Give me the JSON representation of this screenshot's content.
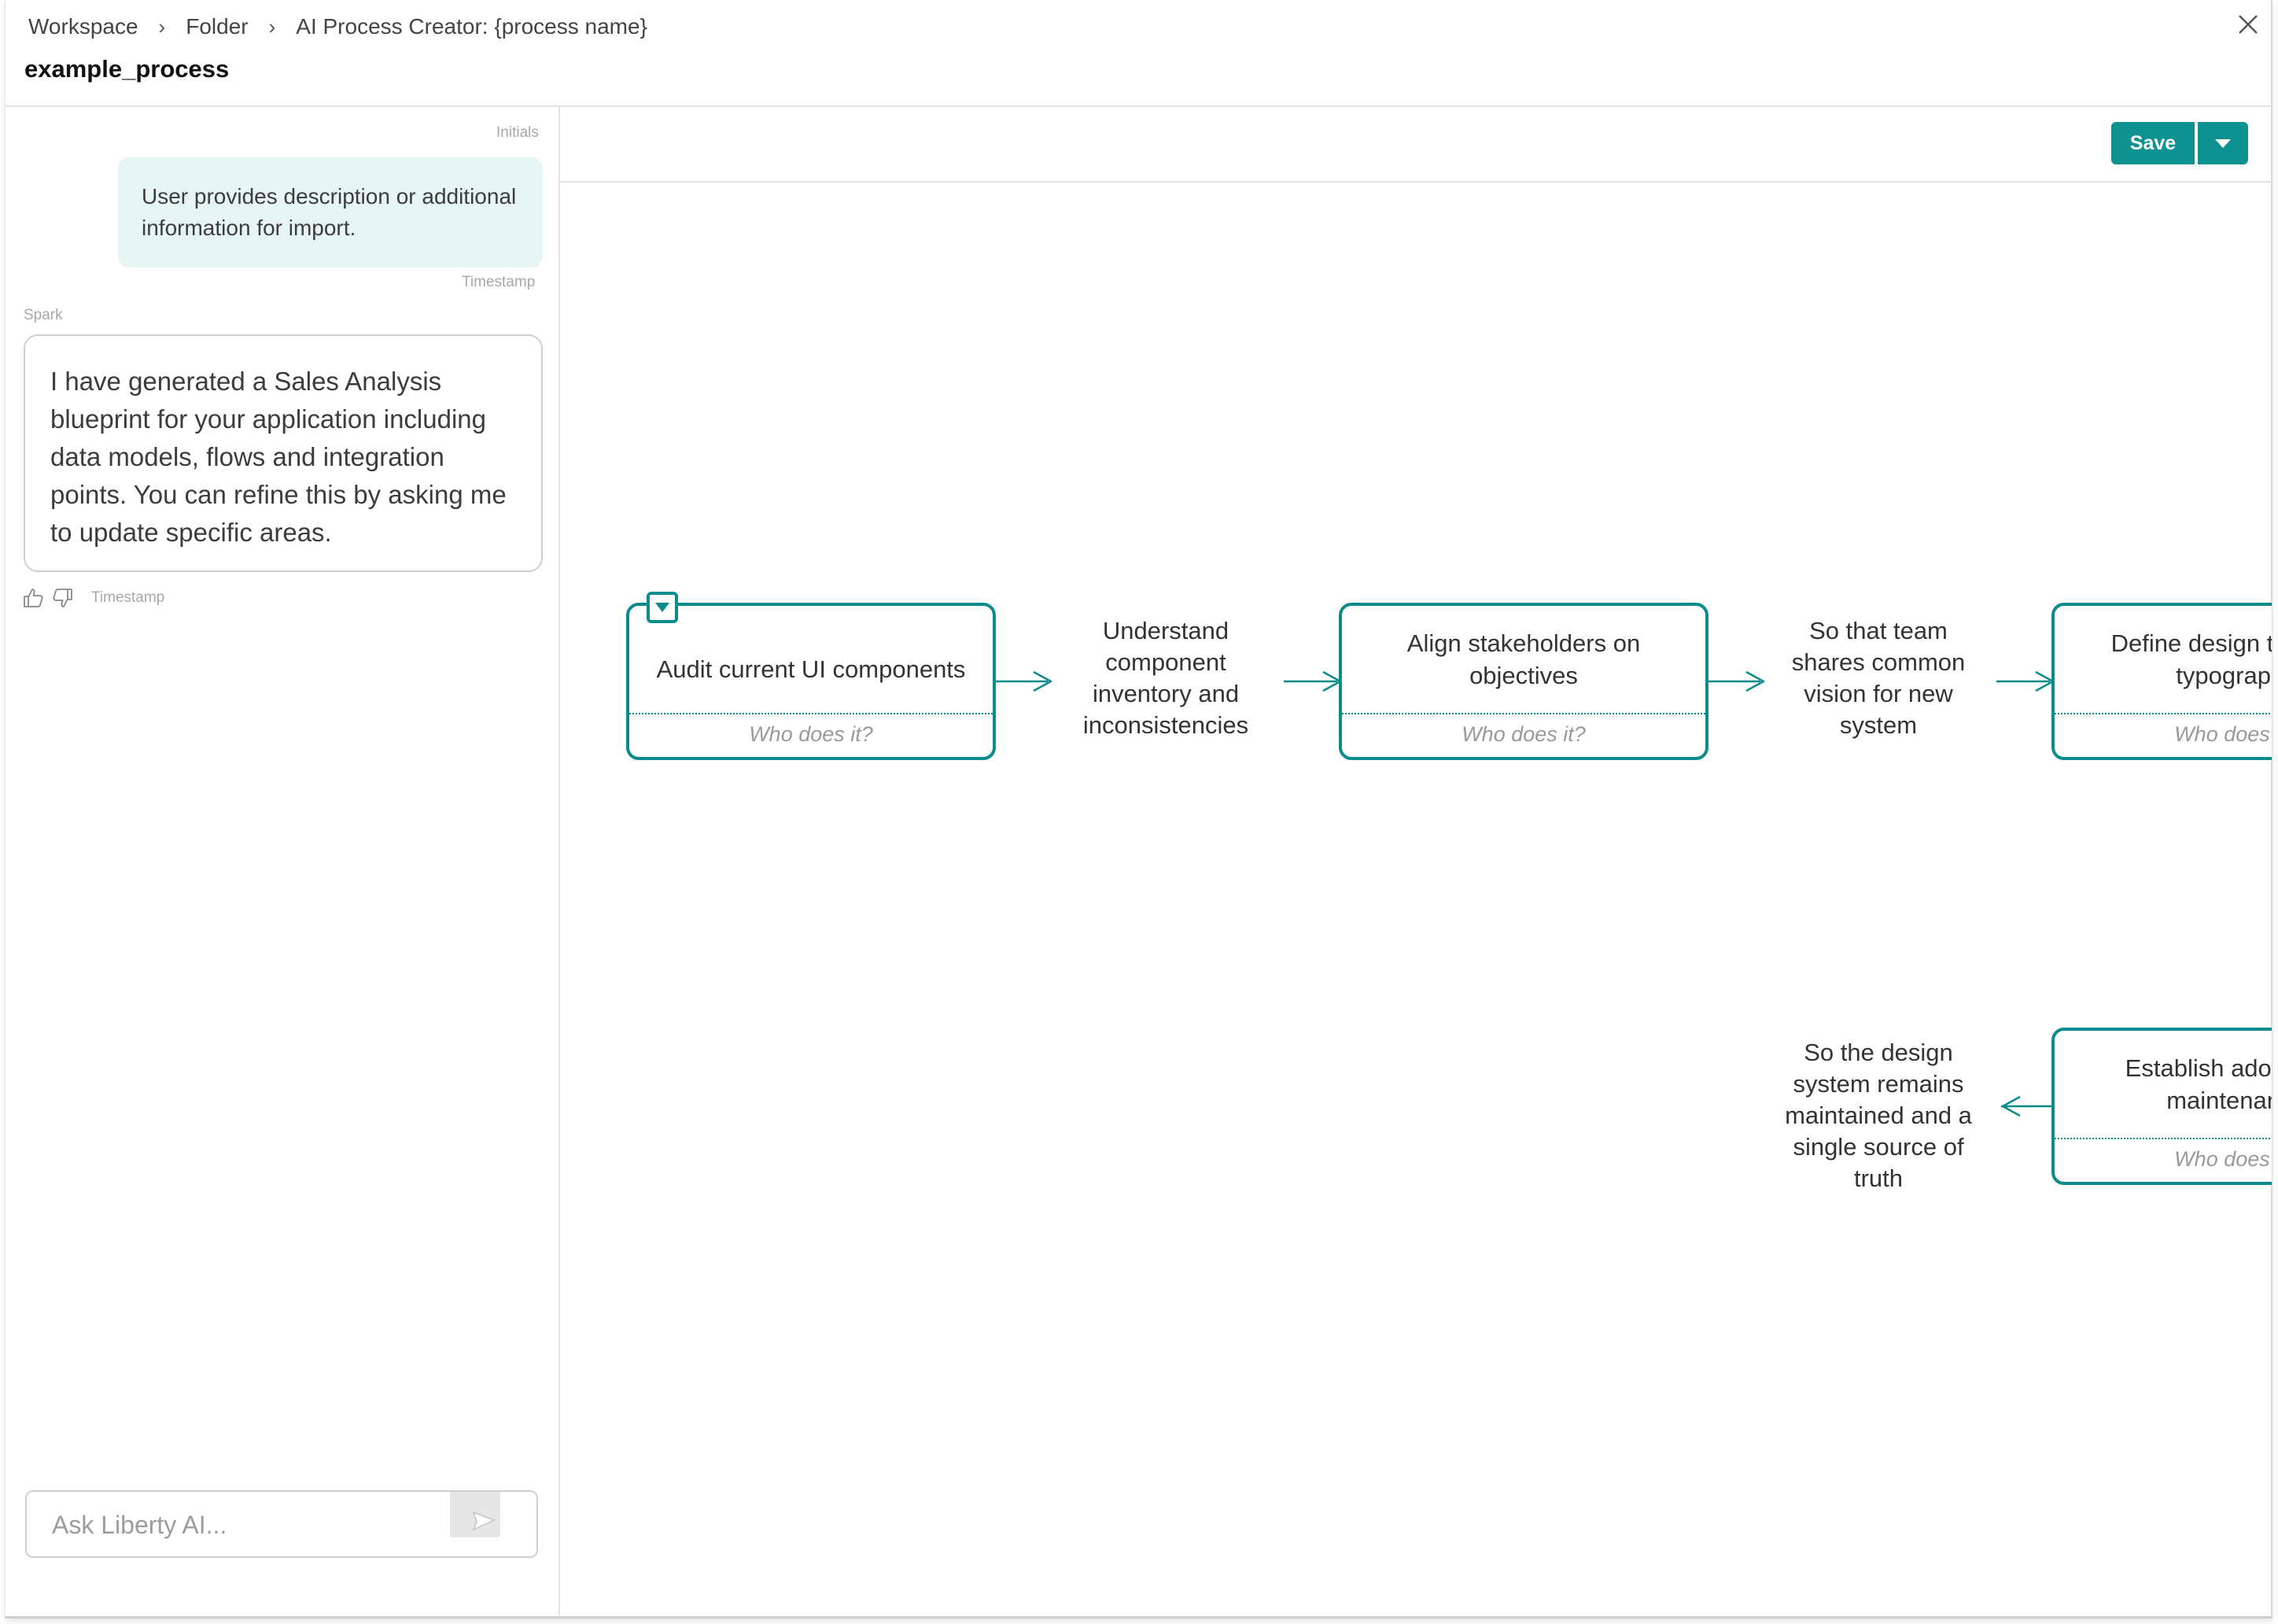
{
  "breadcrumb": [
    "Workspace",
    "Folder",
    "AI Process Creator: {process name}"
  ],
  "page_title": "example_process",
  "icons": {
    "close": "close-icon",
    "chevron": "chevron-right-icon",
    "thumbs_up": "thumbs-up-icon",
    "thumbs_down": "thumbs-down-icon",
    "send": "send-icon",
    "dropdown": "caret-down-icon"
  },
  "colors": {
    "accent": "#0d9191",
    "user_bubble": "#e6f6f4"
  },
  "chat": {
    "user_initials_label": "Initials",
    "user_message": "User provides description or additional information for import.",
    "user_timestamp": "Timestamp",
    "ai_name": "Spark",
    "ai_message": " I have generated a Sales Analysis blueprint for your application including data models, flows and integration points. You can refine this by asking me to update specific areas.",
    "ai_timestamp": "Timestamp",
    "input_placeholder": "Ask Liberty AI..."
  },
  "toolbar": {
    "save_label": "Save"
  },
  "process": {
    "steps": [
      {
        "title": "Audit current UI components",
        "who": "Who does it?"
      },
      {
        "title": "Align stakeholders on objectives",
        "who": "Who does it?"
      },
      {
        "title": "Define design tokens & typography",
        "who": "Who does it?"
      },
      {
        "title": "Establish adoption & maintenance",
        "who": "Who does it?"
      }
    ],
    "outcomes": [
      "Understand component inventory and inconsistencies",
      "So that team shares common vision for new system",
      "So the design system remains maintained and a single source of truth"
    ]
  }
}
